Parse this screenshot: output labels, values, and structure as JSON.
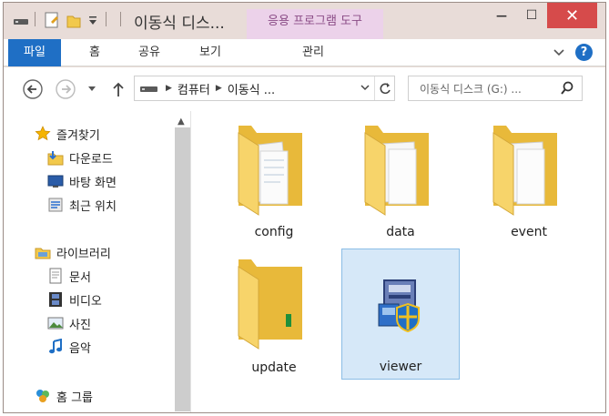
{
  "window": {
    "title": "이동식 디스...",
    "context_tab": "응용 프로그램 도구",
    "controls": {
      "minimize": "—",
      "maximize": "☐",
      "close": "✕"
    }
  },
  "ribbon": {
    "tabs": [
      "파일",
      "홈",
      "공유",
      "보기",
      "관리"
    ],
    "help": "?"
  },
  "nav": {
    "path": [
      "컴퓨터",
      "이동식 ..."
    ],
    "search_placeholder": "이동식 디스크 (G:) ..."
  },
  "sidebar": {
    "favorites": {
      "label": "즐겨찾기",
      "items": [
        "다운로드",
        "바탕 화면",
        "최근 위치"
      ]
    },
    "libraries": {
      "label": "라이브러리",
      "items": [
        "문서",
        "비디오",
        "사진",
        "음악"
      ]
    },
    "homegroup": {
      "label": "홈 그룹"
    }
  },
  "files": [
    {
      "name": "config",
      "type": "folder",
      "selected": false
    },
    {
      "name": "data",
      "type": "folder",
      "selected": false
    },
    {
      "name": "event",
      "type": "folder",
      "selected": false
    },
    {
      "name": "update",
      "type": "folder",
      "selected": false
    },
    {
      "name": "viewer",
      "type": "application",
      "selected": true
    }
  ],
  "colors": {
    "accent": "#1f6fc5",
    "close": "#d64b4b",
    "context_tab": "#ecd2ea",
    "selection": "#d6e8f8"
  }
}
